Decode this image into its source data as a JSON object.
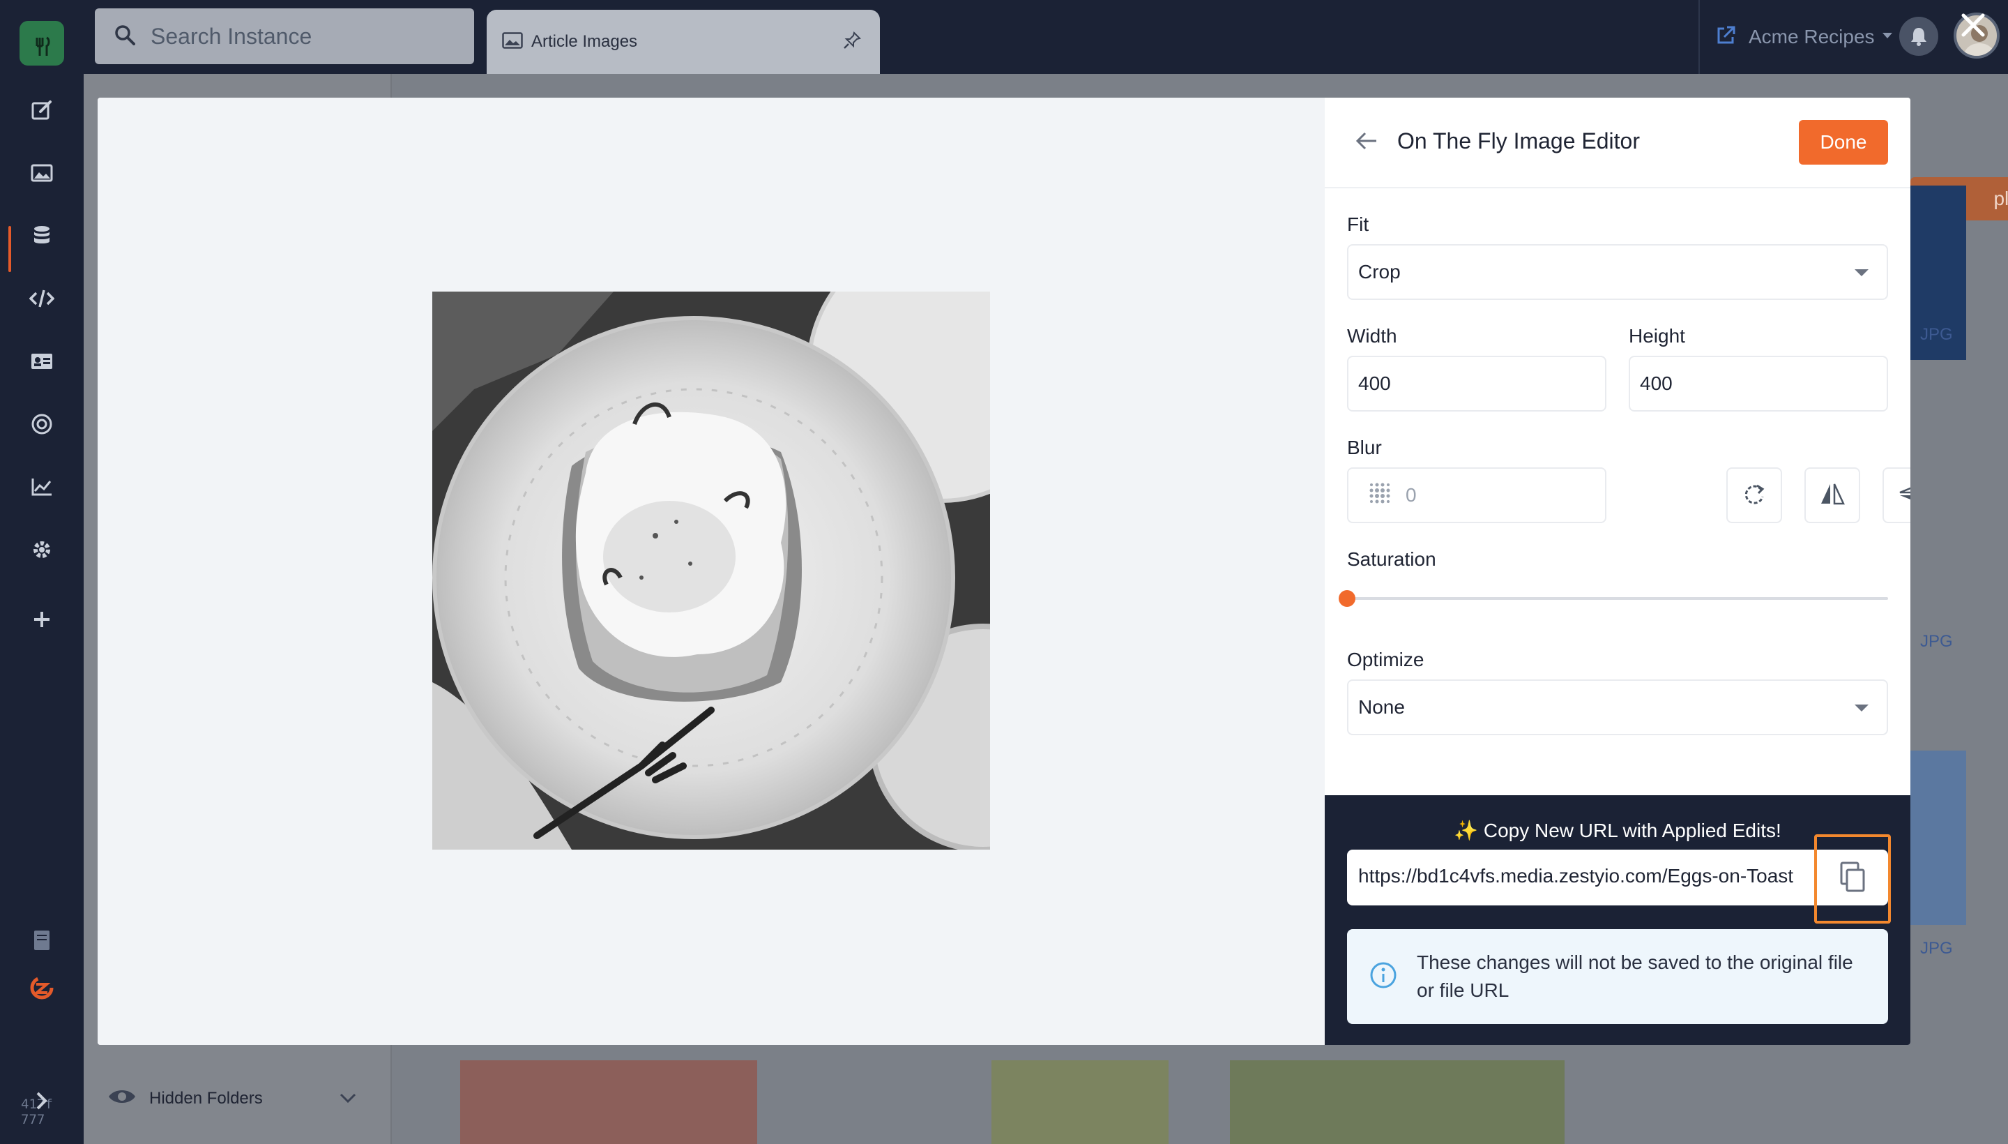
{
  "topbar": {
    "search_placeholder": "Search Instance",
    "tab_label": "Article Images",
    "instance_name": "Acme Recipes"
  },
  "sidebar": {
    "version": "417f\n777"
  },
  "background": {
    "upload_label": "pload",
    "hidden_folders_label": "Hidden Folders",
    "thumb_type_labels": [
      "JPG",
      "JPG",
      "JPG"
    ]
  },
  "editor": {
    "title": "On The Fly Image Editor",
    "done_label": "Done",
    "fit": {
      "label": "Fit",
      "value": "Crop"
    },
    "width": {
      "label": "Width",
      "value": "400"
    },
    "height": {
      "label": "Height",
      "value": "400"
    },
    "blur": {
      "label": "Blur",
      "placeholder": "0"
    },
    "saturation": {
      "label": "Saturation",
      "value": 0
    },
    "optimize": {
      "label": "Optimize",
      "value": "None"
    },
    "copy_heading": "✨ Copy New URL with Applied Edits!",
    "url": "https://bd1c4vfs.media.zestyio.com/Eggs-on-Toast",
    "notice": "These changes will not be saved to the original file or file URL"
  },
  "colors": {
    "accent": "#f16a2c",
    "navy": "#1b2235",
    "highlight": "#f3882e"
  }
}
